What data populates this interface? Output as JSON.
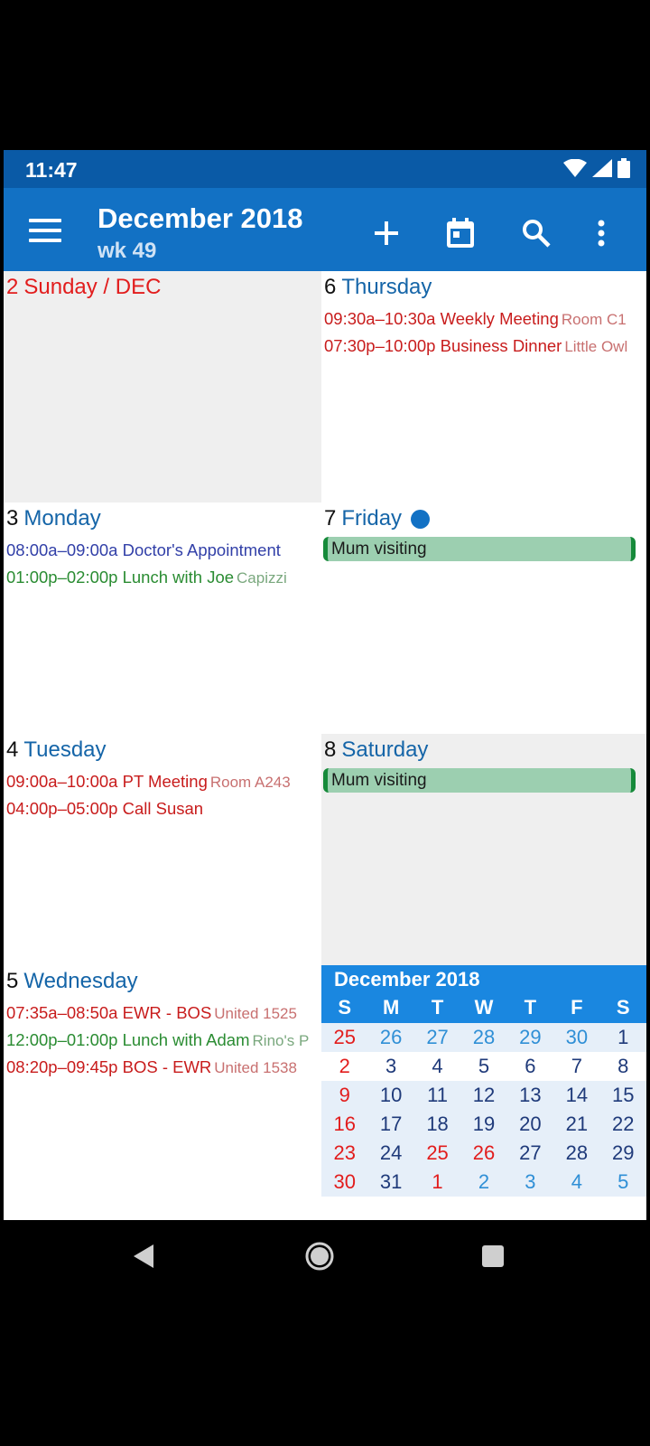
{
  "status": {
    "time": "11:47"
  },
  "appbar": {
    "title": "December 2018",
    "subtitle": "wk 49"
  },
  "days": {
    "sun": {
      "num": "2",
      "name": "Sunday / DEC"
    },
    "mon": {
      "num": "3",
      "name": "Monday",
      "events": [
        {
          "time": "08:00a–09:00a",
          "title": "Doctor's Appointment",
          "loc": ""
        },
        {
          "time": "01:00p–02:00p",
          "title": "Lunch with Joe",
          "loc": "Capizzi"
        }
      ]
    },
    "tue": {
      "num": "4",
      "name": "Tuesday",
      "events": [
        {
          "time": "09:00a–10:00a",
          "title": "PT Meeting",
          "loc": "Room A243"
        },
        {
          "time": "04:00p–05:00p",
          "title": "Call Susan",
          "loc": ""
        }
      ]
    },
    "wed": {
      "num": "5",
      "name": "Wednesday",
      "events": [
        {
          "time": "07:35a–08:50a",
          "title": "EWR - BOS",
          "loc": "United 1525"
        },
        {
          "time": "12:00p–01:00p",
          "title": "Lunch with Adam",
          "loc": "Rino's P"
        },
        {
          "time": "08:20p–09:45p",
          "title": "BOS - EWR",
          "loc": "United 1538"
        }
      ]
    },
    "thu": {
      "num": "6",
      "name": "Thursday",
      "events": [
        {
          "time": "09:30a–10:30a",
          "title": "Weekly Meeting",
          "loc": "Room C1"
        },
        {
          "time": "07:30p–10:00p",
          "title": "Business Dinner",
          "loc": "Little Owl"
        }
      ]
    },
    "fri": {
      "num": "7",
      "name": "Friday",
      "allday": "Mum visiting"
    },
    "sat": {
      "num": "8",
      "name": "Saturday",
      "allday": "Mum visiting"
    }
  },
  "minical": {
    "title": "December 2018",
    "dows": [
      "S",
      "M",
      "T",
      "W",
      "T",
      "F",
      "S"
    ],
    "weeks": [
      [
        "25",
        "26",
        "27",
        "28",
        "29",
        "30",
        "1"
      ],
      [
        "2",
        "3",
        "4",
        "5",
        "6",
        "7",
        "8"
      ],
      [
        "9",
        "10",
        "11",
        "12",
        "13",
        "14",
        "15"
      ],
      [
        "16",
        "17",
        "18",
        "19",
        "20",
        "21",
        "22"
      ],
      [
        "23",
        "24",
        "25",
        "26",
        "27",
        "28",
        "29"
      ],
      [
        "30",
        "31",
        "1",
        "2",
        "3",
        "4",
        "5"
      ]
    ],
    "colors": {
      "current": "#1f3a7a",
      "other": "#2f8fd6",
      "sunday": "#e21d1d",
      "holiday": "#e21d1d"
    }
  }
}
